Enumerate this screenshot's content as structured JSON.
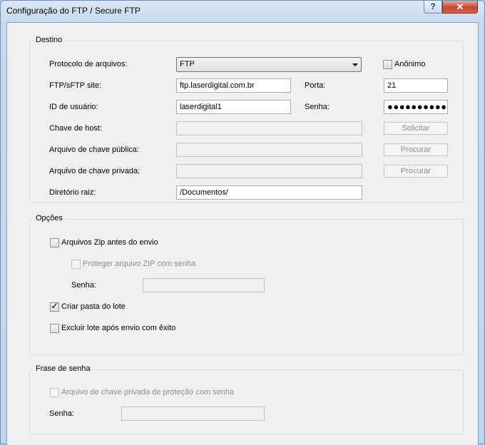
{
  "window": {
    "title": "Configuração do FTP / Secure FTP",
    "help_glyph": "?",
    "close_glyph": "✕"
  },
  "destino": {
    "group_label": "Destino",
    "protocolo": {
      "label": "Protocolo de arquivos:",
      "value": "FTP"
    },
    "anonimo": {
      "label": "Anônimo",
      "checked": false
    },
    "site": {
      "label": "FTP/sFTP site:",
      "value": "ftp.laserdigital.com.br"
    },
    "porta": {
      "label": "Porta:",
      "value": "21"
    },
    "usuario": {
      "label": "ID de usuário:",
      "value": "laserdigital1"
    },
    "senha": {
      "label": "Senha:",
      "value": "●●●●●●●●●●●●"
    },
    "chave_host": {
      "label": "Chave de host:",
      "value": "",
      "button": "Solicitar"
    },
    "chave_publica": {
      "label": "Arquivo de chave pública:",
      "value": "",
      "button": "Procurar"
    },
    "chave_privada": {
      "label": "Arquivo de chave privada:",
      "value": "",
      "button": "Procurar"
    },
    "diretorio": {
      "label": "Diretório raiz:",
      "value": "/Documentos/"
    }
  },
  "opcoes": {
    "group_label": "Opções",
    "zip": {
      "label": "Arquivos Zip antes do envio",
      "checked": false
    },
    "proteger_zip": {
      "label": "Proteger arquivo ZIP com senha",
      "checked": false
    },
    "senha_zip": {
      "label": "Senha:",
      "value": ""
    },
    "criar_pasta": {
      "label": "Criar pasta do lote",
      "checked": true
    },
    "excluir_lote": {
      "label": "Excluir lote após envio com êxito",
      "checked": false
    }
  },
  "frase": {
    "group_label": "Frase de senha",
    "protecao": {
      "label": "Arquivo de chave privada de proteção com senha",
      "checked": false
    },
    "senha": {
      "label": "Senha:",
      "value": ""
    }
  },
  "check_glyph": "✓"
}
